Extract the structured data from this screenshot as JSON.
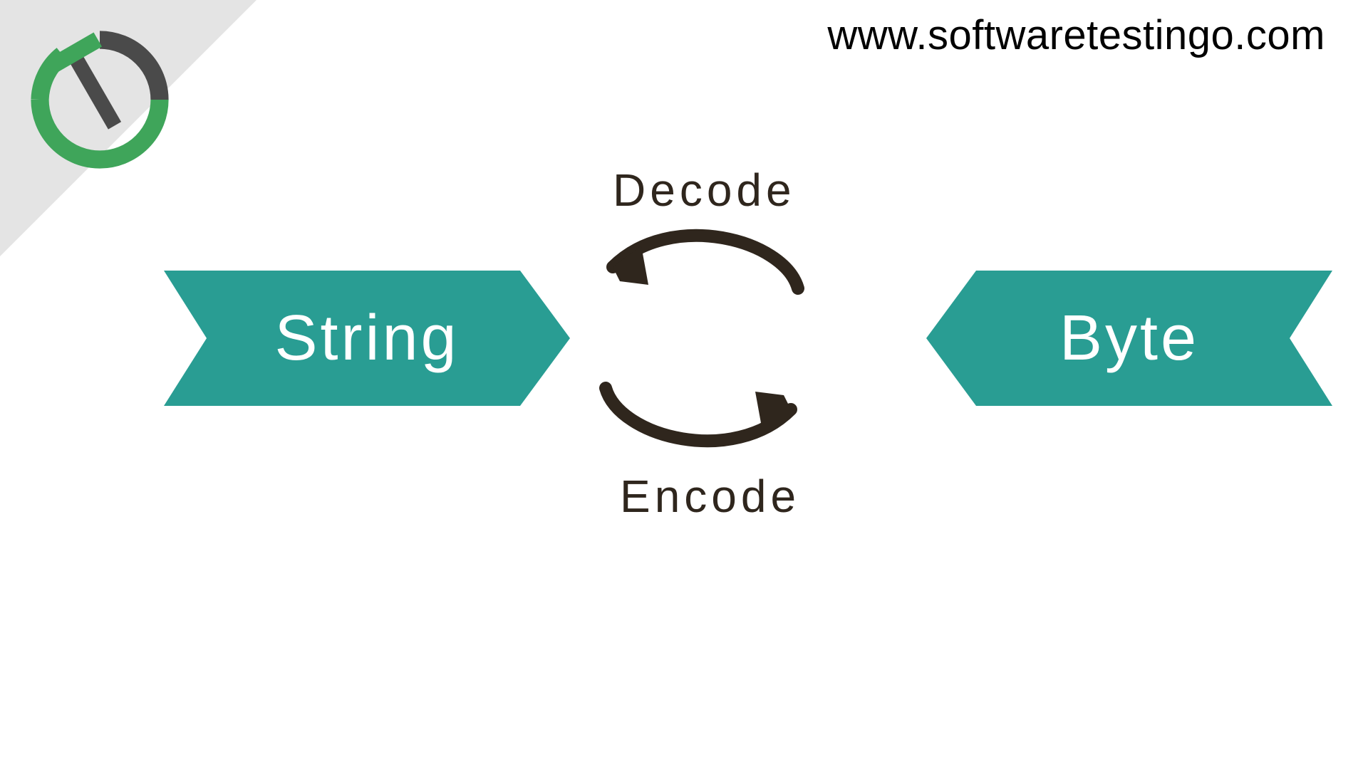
{
  "header": {
    "url": "www.softwaretestingo.com"
  },
  "diagram": {
    "left_box": "String",
    "right_box": "Byte",
    "top_label": "Decode",
    "bottom_label": "Encode"
  },
  "colors": {
    "box": "#299d93",
    "arrow": "#2f261d",
    "triangle": "#e4e4e4",
    "logo_green": "#3fa55a",
    "logo_dark": "#4a4a4a"
  }
}
